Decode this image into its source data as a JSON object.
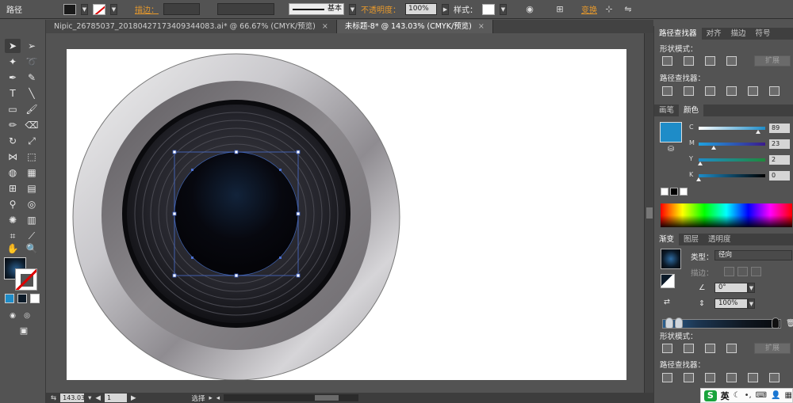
{
  "control_bar": {
    "object_type": "路径",
    "stroke_label": "描边：",
    "stroke_style": "基本",
    "opacity_label": "不透明度：",
    "opacity_value": "100%",
    "style_label": "样式：",
    "transform_label": "变换"
  },
  "tabs": [
    {
      "label": "Nipic_26785037_20180427173409344083.ai* @ 66.67% (CMYK/预览)",
      "close": "×"
    },
    {
      "label": "未标题-8* @ 143.03% (CMYK/预览)",
      "close": "×"
    }
  ],
  "status_bar": {
    "zoom": "143.03",
    "artboard": "1",
    "mode": "选择"
  },
  "panels": {
    "top_tabs": [
      "路径查找器",
      "对齐",
      "描边",
      "符号"
    ],
    "shape_modes_label": "形状模式：",
    "pathfinders_label": "路径查找器：",
    "expand_label": "扩展",
    "color_tabs": [
      "画笔",
      "颜色"
    ],
    "cmyk": [
      {
        "channel": "C",
        "value": "89",
        "percent": 89
      },
      {
        "channel": "M",
        "value": "23",
        "percent": 23
      },
      {
        "channel": "Y",
        "value": "2",
        "percent": 2
      },
      {
        "channel": "K",
        "value": "0",
        "percent": 0
      }
    ],
    "gradient_tabs": [
      "渐变",
      "图层",
      "透明度"
    ],
    "type_label": "类型：",
    "type_value": "径向",
    "stroke_label": "描边：",
    "angle_value": "0°",
    "aspect_value": "100%",
    "shape_modes_label_2": "形状模式：",
    "pathfinders_label_2": "路径查找器："
  },
  "ime": {
    "logo": "S",
    "lang": "英"
  },
  "colors": {
    "accent_orange": "#e89a2c",
    "cmyk_swatch": "#1e8cc8",
    "ui_bg": "#535353"
  }
}
